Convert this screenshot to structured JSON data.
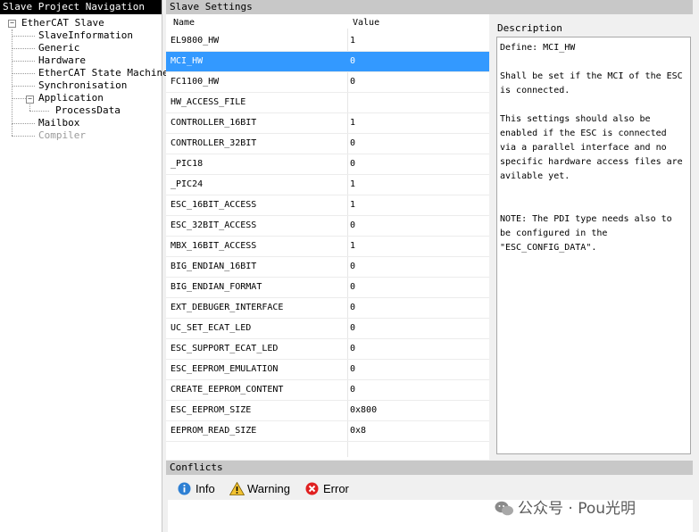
{
  "navigation": {
    "title": "Slave Project Navigation",
    "items": [
      {
        "label": "EtherCAT Slave"
      },
      {
        "label": "SlaveInformation"
      },
      {
        "label": "Generic"
      },
      {
        "label": "Hardware"
      },
      {
        "label": "EtherCAT State Machine"
      },
      {
        "label": "Synchronisation"
      },
      {
        "label": "Application"
      },
      {
        "label": "ProcessData"
      },
      {
        "label": "Mailbox"
      },
      {
        "label": "Compiler"
      }
    ]
  },
  "settings": {
    "title": "Slave Settings",
    "columns": {
      "name": "Name",
      "value": "Value"
    },
    "rows": [
      {
        "name": "EL9800_HW",
        "value": "1"
      },
      {
        "name": "MCI_HW",
        "value": "0"
      },
      {
        "name": "FC1100_HW",
        "value": "0"
      },
      {
        "name": "HW_ACCESS_FILE",
        "value": ""
      },
      {
        "name": "CONTROLLER_16BIT",
        "value": "1"
      },
      {
        "name": "CONTROLLER_32BIT",
        "value": "0"
      },
      {
        "name": "_PIC18",
        "value": "0"
      },
      {
        "name": "_PIC24",
        "value": "1"
      },
      {
        "name": "ESC_16BIT_ACCESS",
        "value": "1"
      },
      {
        "name": "ESC_32BIT_ACCESS",
        "value": "0"
      },
      {
        "name": "MBX_16BIT_ACCESS",
        "value": "1"
      },
      {
        "name": "BIG_ENDIAN_16BIT",
        "value": "0"
      },
      {
        "name": "BIG_ENDIAN_FORMAT",
        "value": "0"
      },
      {
        "name": "EXT_DEBUGER_INTERFACE",
        "value": "0"
      },
      {
        "name": "UC_SET_ECAT_LED",
        "value": "0"
      },
      {
        "name": "ESC_SUPPORT_ECAT_LED",
        "value": "0"
      },
      {
        "name": "ESC_EEPROM_EMULATION",
        "value": "0"
      },
      {
        "name": "CREATE_EEPROM_CONTENT",
        "value": "0"
      },
      {
        "name": "ESC_EEPROM_SIZE",
        "value": "0x800"
      },
      {
        "name": "EEPROM_READ_SIZE",
        "value": "0x8"
      }
    ]
  },
  "description": {
    "title": "Description",
    "text": "Define: MCI_HW\n\nShall be set if the MCI of the ESC\nis connected.\n\nThis settings should also be\nenabled if the ESC is connected\nvia a parallel interface and no\nspecific hardware access files are\navilable yet.\n\n\nNOTE: The PDI type needs also to\nbe configured in the\n\"ESC_CONFIG_DATA\"."
  },
  "conflicts": {
    "title": "Conflicts",
    "tabs": [
      {
        "label": "Info",
        "icon": "info-icon",
        "color": "#2d7fd3"
      },
      {
        "label": "Warning",
        "icon": "warning-icon",
        "color": "#f2c230"
      },
      {
        "label": "Error",
        "icon": "error-icon",
        "color": "#e02020"
      }
    ]
  },
  "watermark": {
    "text": "公众号 · Pou光明"
  },
  "colors": {
    "selection": "#3399ff",
    "header": "#c8c8c8"
  }
}
